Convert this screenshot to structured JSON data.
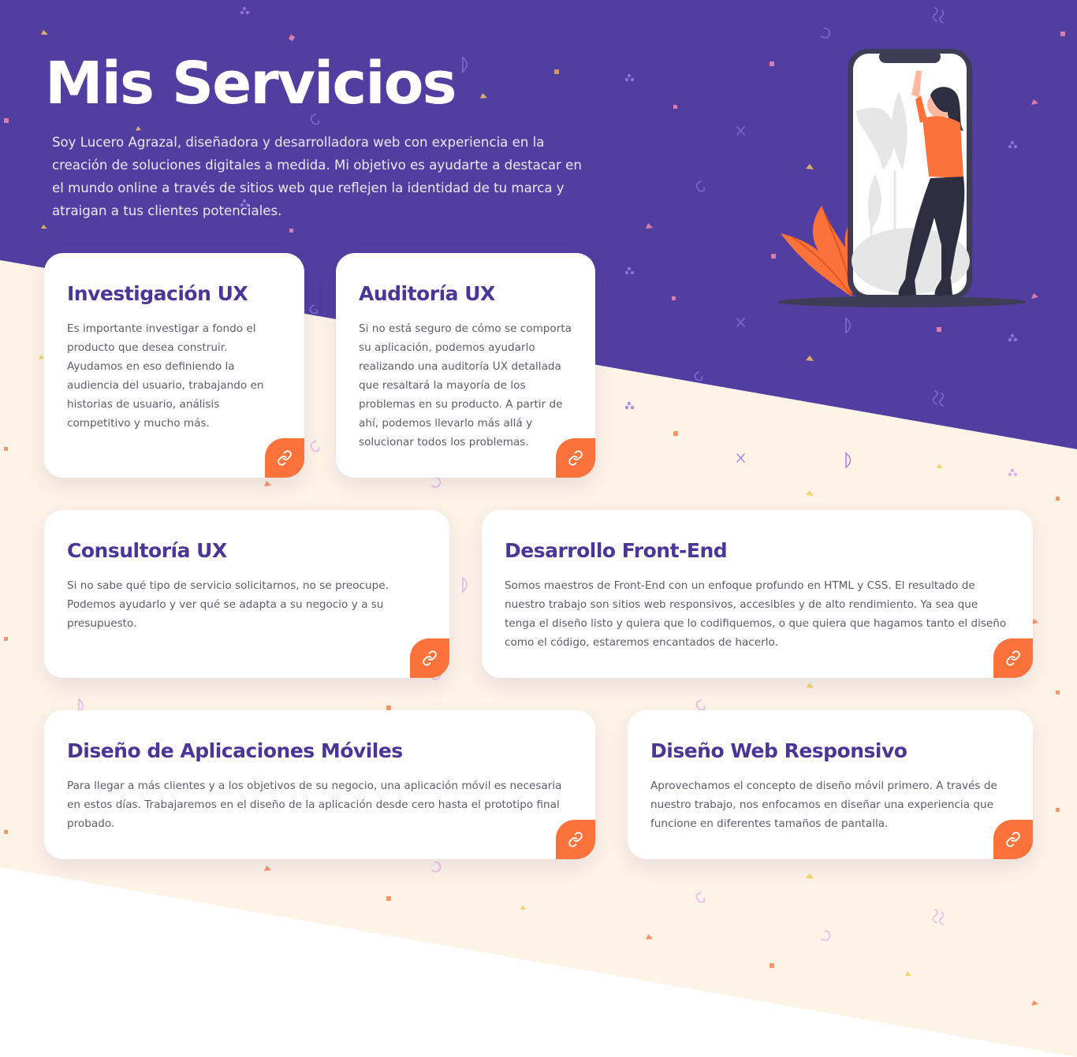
{
  "hero": {
    "title": "Mis Servicios",
    "description": "Soy Lucero Agrazal, diseñadora y desarrolladora web con experiencia en la creación de soluciones digitales a medida. Mi objetivo es ayudarte a destacar en el mundo online a través de sitios web que reflejen la identidad de tu marca y atraigan a tus clientes potenciales."
  },
  "colors": {
    "hero_background": "#523ea0",
    "lower_background": "#fdf3e7",
    "title_color": "#4a3697",
    "accent": "#fb733a",
    "card_background": "#ffffff"
  },
  "illustration": {
    "name": "woman-on-phone-illustration"
  },
  "services": [
    {
      "title": "Investigación UX",
      "text": "Es importante investigar a fondo el producto que desea construir. Ayudamos en eso definiendo la audiencia del usuario, trabajando en historias de usuario, análisis competitivo y mucho más.",
      "icon": "link-icon"
    },
    {
      "title": "Auditoría UX",
      "text": "Si no está seguro de cómo se comporta su aplicación, podemos ayudarlo realizando una auditoría UX detallada que resaltará la mayoría de los problemas en su producto. A partir de ahí, podemos llevarlo más allá y solucionar todos los problemas.",
      "icon": "link-icon"
    },
    {
      "title": "Consultoría UX",
      "text": "Si no sabe qué tipo de servicio solicitarnos, no se preocupe. Podemos ayudarlo y ver qué se adapta a su negocio y a su presupuesto.",
      "icon": "link-icon"
    },
    {
      "title": "Desarrollo Front-End",
      "text": "Somos maestros de Front-End con un enfoque profundo en HTML y CSS. El resultado de nuestro trabajo son sitios web responsivos, accesibles y de alto rendimiento. Ya sea que tenga el diseño listo y quiera que lo codifiquemos, o que quiera que hagamos tanto el diseño como el código, estaremos encantados de hacerlo.",
      "icon": "link-icon"
    },
    {
      "title": "Diseño de Aplicaciones Móviles",
      "text": "Para llegar a más clientes y a los objetivos de su negocio, una aplicación móvil es necesaria en estos días. Trabajaremos en el diseño de la aplicación desde cero hasta el prototipo final probado.",
      "icon": "link-icon"
    },
    {
      "title": "Diseño Web Responsivo",
      "text": "Aprovechamos el concepto de diseño móvil primero. A través de nuestro trabajo, nos enfocamos en diseñar una experiencia que funcione en diferentes tamaños de pantalla.",
      "icon": "link-icon"
    }
  ]
}
